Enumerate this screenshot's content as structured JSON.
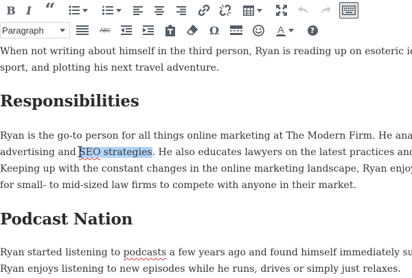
{
  "toolbar": {
    "row1": [
      {
        "name": "bold-button",
        "icon": "bold-icon"
      },
      {
        "name": "italic-button",
        "icon": "italic-icon"
      },
      {
        "name": "blockquote-button",
        "icon": "blockquote-icon"
      },
      {
        "name": "bulleted-list-button",
        "icon": "bulleted-list-icon",
        "dropdown": true
      },
      {
        "name": "numbered-list-button",
        "icon": "numbered-list-icon",
        "dropdown": true
      },
      {
        "name": "align-left-button",
        "icon": "align-left-icon"
      },
      {
        "name": "align-center-button",
        "icon": "align-center-icon"
      },
      {
        "name": "align-right-button",
        "icon": "align-right-icon"
      },
      {
        "name": "insert-link-button",
        "icon": "link-icon"
      },
      {
        "name": "remove-link-button",
        "icon": "unlink-icon"
      },
      {
        "name": "table-button",
        "icon": "table-icon",
        "dropdown": true
      },
      {
        "name": "fullscreen-button",
        "icon": "fullscreen-icon"
      },
      {
        "name": "undo-button",
        "icon": "undo-icon",
        "state": "disabled"
      },
      {
        "name": "redo-button",
        "icon": "redo-icon",
        "state": "disabled"
      },
      {
        "name": "toolbar-toggle-button",
        "icon": "keyboard-icon",
        "state": "active"
      }
    ],
    "row2": [
      {
        "name": "horizontal-line-button",
        "icon": "horizontal-lines-icon"
      },
      {
        "name": "strikethrough-button",
        "icon": "strikethrough-icon"
      },
      {
        "name": "outdent-button",
        "icon": "outdent-icon"
      },
      {
        "name": "indent-button",
        "icon": "indent-icon"
      },
      {
        "name": "paste-as-text-button",
        "icon": "clipboard-icon"
      },
      {
        "name": "clear-formatting-button",
        "icon": "eraser-icon"
      },
      {
        "name": "special-character-button",
        "icon": "omega-icon"
      },
      {
        "name": "read-more-button",
        "icon": "read-more-icon"
      },
      {
        "name": "emoji-button",
        "icon": "smiley-icon"
      },
      {
        "name": "text-color-button",
        "icon": "text-color-icon",
        "dropdown": true
      },
      {
        "name": "help-button",
        "icon": "help-icon"
      }
    ],
    "format_select": {
      "value": "Paragraph"
    },
    "glyphs": {
      "bold": "B",
      "italic": "I",
      "quote": "“",
      "strike": "ABC",
      "omega": "Ω",
      "help": "?",
      "color": "A"
    }
  },
  "colors": {
    "icon": "#555d66",
    "icon_disabled": "#c4c9ce",
    "selection": "#b3d4fd",
    "text_color_bar": "#555d66",
    "spellcheck": "#d63638"
  },
  "content": {
    "p1": {
      "line1": "When not writing about himself in the third person, Ryan is reading up on esoteric id",
      "line2": "sport, and plotting his next travel adventure."
    },
    "h_responsibilities": "Responsibilities",
    "p2": {
      "line1": "Ryan is the go-to person for all things online marketing at The Modern Firm. He anal",
      "line2_before": "advertising and ",
      "line2_sel_spell": "SEO",
      "line2_sel_rest": " strategies",
      "line2_after": ". He also educates lawyers on the latest practices and to",
      "line3": "Keeping up with the constant changes in the online marketing landscape, Ryan enjoys",
      "line4": "for small- to mid-sized law firms to compete with anyone in their market."
    },
    "h_podcast": "Podcast Nation",
    "p3": {
      "line1_before": "Ryan started listening to ",
      "line1_spell": "podcasts",
      "line1_after": " a few years ago and found himself immediately suc",
      "line2": "Ryan enjoys listening to new episodes while he runs, drives or simply just relaxes."
    }
  }
}
